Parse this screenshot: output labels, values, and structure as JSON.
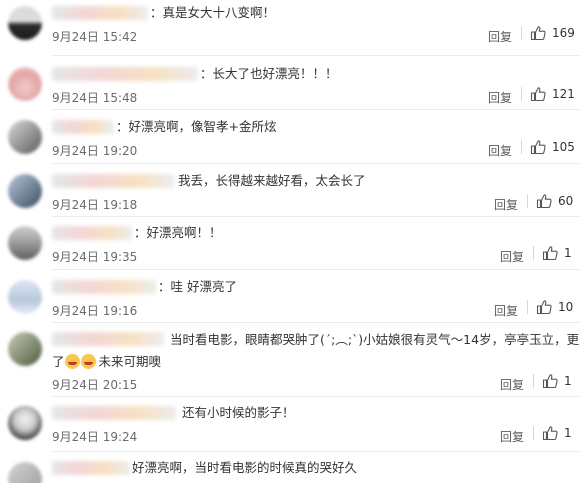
{
  "comments": [
    {
      "text": "：真是女大十八变啊！",
      "date": "9月24日",
      "time": "15:42",
      "reply": "回复",
      "likes": "169"
    },
    {
      "text": "：长大了也好漂亮！！！",
      "date": "9月24日",
      "time": "15:48",
      "reply": "回复",
      "likes": "121"
    },
    {
      "text": "：好漂亮啊，像智孝+金所炫",
      "date": "9月24日",
      "time": "19:20",
      "reply": "回复",
      "likes": "105"
    },
    {
      "text": "我丢，长得越来越好看，太会长了",
      "date": "9月24日",
      "time": "19:18",
      "reply": "回复",
      "likes": "60"
    },
    {
      "text": "：好漂亮啊！！",
      "date": "9月24日",
      "time": "19:35",
      "reply": "回复",
      "likes": "1"
    },
    {
      "text": "：哇 好漂亮了",
      "date": "9月24日",
      "time": "19:16",
      "reply": "回复",
      "likes": "10"
    },
    {
      "text_a": "当时看电影，眼睛都哭肿了(´;︵;`)小姑娘很有灵气～14岁，亭亭玉立，更美了",
      "text_b": "未来可期噢",
      "date": "9月24日",
      "time": "20:15",
      "reply": "回复",
      "likes": "1"
    },
    {
      "text": "还有小时候的影子！",
      "date": "9月24日",
      "time": "19:24",
      "reply": "回复",
      "likes": "1"
    },
    {
      "text": "好漂亮啊，当时看电影的时候真的哭好久"
    }
  ],
  "colors": {
    "meta": "#6b6b6b",
    "divider": "#ececec",
    "emoji": "#f7c948"
  },
  "icons": {
    "like": "thumbs-up-icon"
  }
}
